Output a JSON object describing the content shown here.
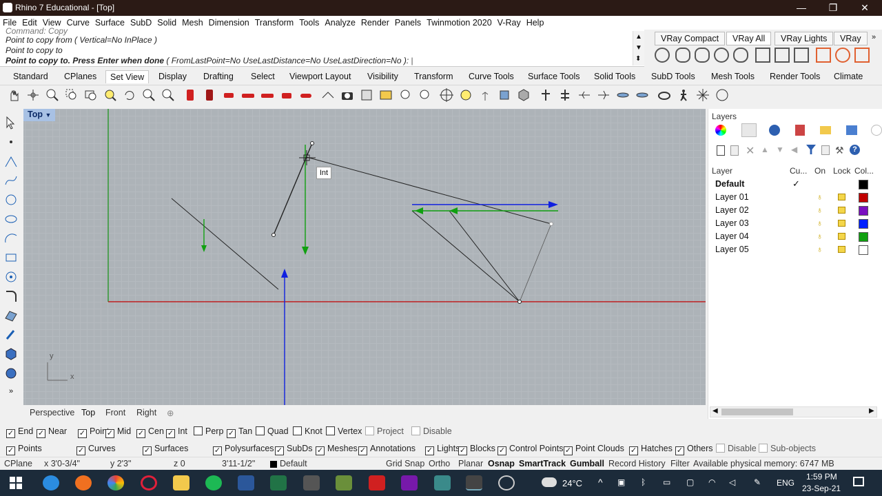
{
  "window": {
    "title": "Rhino 7 Educational - [Top]",
    "minimize": "—",
    "restore": "❐",
    "close": "✕"
  },
  "menu": [
    "File",
    "Edit",
    "View",
    "Curve",
    "Surface",
    "SubD",
    "Solid",
    "Mesh",
    "Dimension",
    "Transform",
    "Tools",
    "Analyze",
    "Render",
    "Panels",
    "Twinmotion 2020",
    "V-Ray",
    "Help"
  ],
  "command": {
    "line1": "Command: Copy",
    "line2": "Point to copy from ( Vertical=No  InPlace )",
    "line3": "Point to copy to",
    "prompt": "Point to copy to. Press Enter when done",
    "options": "( FromLastPoint=No  UseLastDistance=No  UseLastDirection=No ):"
  },
  "vray_tabs": [
    "VRay Compact",
    "VRay All",
    "VRay Lights",
    "VRay"
  ],
  "toolbar_tabs": [
    "Standard",
    "CPlanes",
    "Set View",
    "Display",
    "Drafting",
    "Select",
    "Viewport Layout",
    "Visibility",
    "Transform",
    "Curve Tools",
    "Surface Tools",
    "Solid Tools",
    "SubD Tools",
    "Mesh Tools",
    "Render Tools",
    "Climate"
  ],
  "active_tab": "Set View",
  "viewport": {
    "label": "Top",
    "tooltip": "Int",
    "axis_y": "y",
    "axis_x": "x"
  },
  "viewport_tabs": [
    "Perspective",
    "Top",
    "Front",
    "Right"
  ],
  "layers": {
    "title": "Layers",
    "columns": {
      "layer": "Layer",
      "current": "Cu...",
      "on": "On",
      "lock": "Lock",
      "color": "Col..."
    },
    "rows": [
      {
        "name": "Default",
        "current": "✓",
        "color": "#000000",
        "bold": true
      },
      {
        "name": "Layer 01",
        "current": "",
        "color": "#c00000"
      },
      {
        "name": "Layer 02",
        "current": "",
        "color": "#7a10c0"
      },
      {
        "name": "Layer 03",
        "current": "",
        "color": "#0020ff"
      },
      {
        "name": "Layer 04",
        "current": "",
        "color": "#10a010"
      },
      {
        "name": "Layer 05",
        "current": "",
        "color": "#ffffff"
      }
    ]
  },
  "osnaps": [
    {
      "label": "End",
      "checked": true
    },
    {
      "label": "Near",
      "checked": true
    },
    {
      "label": "Point",
      "checked": true
    },
    {
      "label": "Mid",
      "checked": true
    },
    {
      "label": "Cen",
      "checked": true
    },
    {
      "label": "Int",
      "checked": true
    },
    {
      "label": "Perp",
      "checked": false
    },
    {
      "label": "Tan",
      "checked": true
    },
    {
      "label": "Quad",
      "checked": false
    },
    {
      "label": "Knot",
      "checked": false
    },
    {
      "label": "Vertex",
      "checked": false
    },
    {
      "label": "Project",
      "checked": false,
      "disabled": true
    },
    {
      "label": "Disable",
      "checked": false,
      "disabled": true
    }
  ],
  "filters": [
    {
      "label": "Points",
      "checked": true
    },
    {
      "label": "Curves",
      "checked": true
    },
    {
      "label": "Surfaces",
      "checked": true
    },
    {
      "label": "Polysurfaces",
      "checked": true
    },
    {
      "label": "SubDs",
      "checked": true
    },
    {
      "label": "Meshes",
      "checked": true
    },
    {
      "label": "Annotations",
      "checked": true
    },
    {
      "label": "Lights",
      "checked": true
    },
    {
      "label": "Blocks",
      "checked": true
    },
    {
      "label": "Control Points",
      "checked": true
    },
    {
      "label": "Point Clouds",
      "checked": true
    },
    {
      "label": "Hatches",
      "checked": true
    },
    {
      "label": "Others",
      "checked": true
    },
    {
      "label": "Disable",
      "checked": false,
      "disabled": true
    },
    {
      "label": "Sub-objects",
      "checked": false,
      "disabled": true
    }
  ],
  "status": {
    "cplane": "CPlane",
    "x": "x 3'0-3/4\"",
    "y": "y 2'3\"",
    "z": "z 0",
    "dist": "3'11-1/2\"",
    "layer": "Default",
    "grid_snap": "Grid Snap",
    "ortho": "Ortho",
    "planar": "Planar",
    "osnap": "Osnap",
    "smarttrack": "SmartTrack",
    "gumball": "Gumball",
    "record": "Record History",
    "filter": "Filter",
    "memory": "Available physical memory: 6747 MB"
  },
  "taskbar": {
    "temp": "24°C",
    "lang": "ENG",
    "time": "1:59 PM",
    "date": "23-Sep-21"
  },
  "colors": {
    "x_axis": "#c00000",
    "y_axis": "#109010",
    "gumball_blue": "#1020e0",
    "gumball_green": "#10a010",
    "viewport_bg": "#adb3b8"
  }
}
